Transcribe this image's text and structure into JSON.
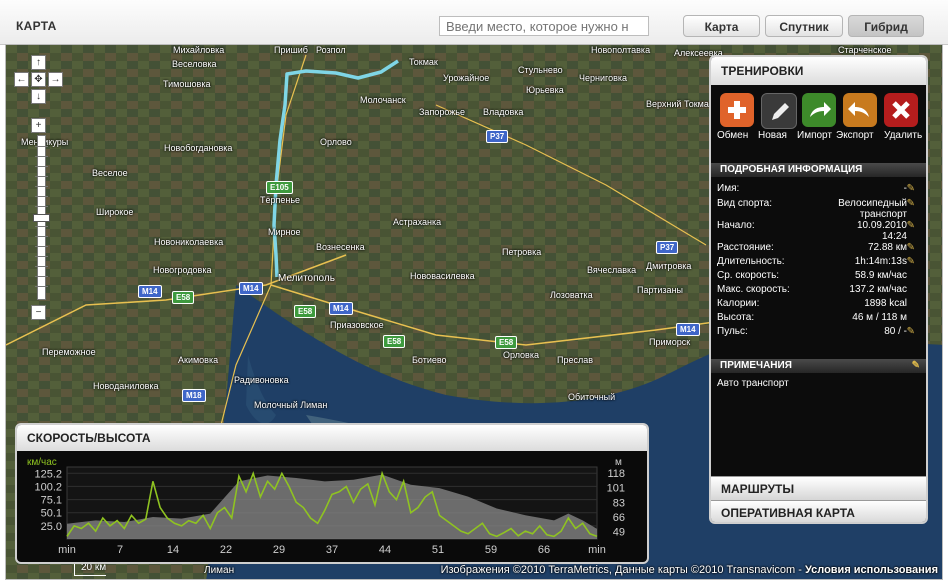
{
  "header": {
    "title": "КАРТА",
    "search_placeholder": "Введи место, которое нужно н",
    "map_types": [
      {
        "label": "Карта",
        "active": false
      },
      {
        "label": "Спутник",
        "active": false
      },
      {
        "label": "Гибрид",
        "active": true
      }
    ]
  },
  "map": {
    "places": [
      "Михайловка",
      "Пришиб",
      "Розпол",
      "Новополтавка",
      "Алексеевка",
      "Старченское",
      "Токмак",
      "Веселовка",
      "Тимошовка",
      "Урожайное",
      "Стульнево",
      "Юрьевка",
      "Молочанск",
      "Запорожье",
      "Черниговка",
      "Владовка",
      "Верхний Токмак",
      "Менчикуры",
      "Новобогдановка",
      "Орлово",
      "Тёрпенье",
      "Веселое",
      "Широкое",
      "Астраханка",
      "Новониколаевка",
      "Мирное",
      "Вознесенка",
      "Петровка",
      "Новогродовка",
      "Мелитополь",
      "Нововасилевка",
      "Вячеславка",
      "Дмитровка",
      "Партизаны",
      "Приазовское",
      "Лозоватка",
      "Переможное",
      "Акимовка",
      "Ботиево",
      "Приморск",
      "Орловка",
      "Преслав",
      "Радивоновка",
      "Новоданиловка",
      "Обиточный",
      "Молочный Лиман",
      "Лиман"
    ],
    "roads": [
      "M14",
      "E58",
      "P37",
      "M18",
      "E105"
    ],
    "scale_label": "20 км",
    "copyright_text": "Изображения ©2010 TerraMetrics, Данные карты ©2010 Transnavicom - ",
    "terms_link": "Условия использования"
  },
  "workouts_panel": {
    "title": "ТРЕНИРОВКИ",
    "toolbar": [
      {
        "label": "Обмен",
        "icon": "plus-icon",
        "color": "#e0632a"
      },
      {
        "label": "Новая",
        "icon": "pencil-icon",
        "color": "#3a3a3a"
      },
      {
        "label": "Импорт",
        "icon": "import-arrow-icon",
        "color": "#3d8a2a"
      },
      {
        "label": "Экспорт",
        "icon": "export-arrow-icon",
        "color": "#c87a1e"
      },
      {
        "label": "Удалить",
        "icon": "delete-x-icon",
        "color": "#b51d1d"
      }
    ],
    "details_title": "ПОДРОБНАЯ ИНФОРМАЦИЯ",
    "details": [
      {
        "key": "Имя:",
        "value": "-"
      },
      {
        "key": "Вид спорта:",
        "value": "Велосипедный транспорт"
      },
      {
        "key": "Начало:",
        "value": "10.09.2010 14:24"
      },
      {
        "key": "Расстояние:",
        "value": "72.88 км"
      },
      {
        "key": "Длительность:",
        "value": "1h:14m:13s"
      },
      {
        "key": "Ср. скорость:",
        "value": "58.9 км/час"
      },
      {
        "key": "Макс. скорость:",
        "value": "137.2 км/час"
      },
      {
        "key": "Калории:",
        "value": "1898 kcal"
      },
      {
        "key": "Высота:",
        "value": "46 м / 118 м"
      },
      {
        "key": "Пульс:",
        "value": "80 / -"
      }
    ],
    "notes_title": "ПРИМЕЧАНИЯ",
    "notes_text": "Авто транспорт",
    "routes_label": "МАРШРУТЫ",
    "live_map_label": "ОПЕРАТИВНАЯ КАРТА"
  },
  "chart_data": {
    "type": "line",
    "title": "СКОРОСТЬ/ВЫСОТА",
    "ylabel": "км/час",
    "y2label": "м",
    "x_tick_labels": [
      "min",
      "7",
      "14",
      "22",
      "29",
      "37",
      "44",
      "51",
      "59",
      "66",
      "min"
    ],
    "y_ticks": [
      "125.2",
      "100.2",
      "75.1",
      "50.1",
      "25.0"
    ],
    "y2_ticks": [
      "118",
      "101",
      "83",
      "66",
      "49"
    ],
    "ylim": [
      0,
      137.2
    ],
    "y2lim": [
      40,
      125
    ],
    "xlim": [
      0,
      74
    ],
    "series": [
      {
        "name": "speed",
        "color": "#8fc321",
        "x": [
          0,
          1,
          2,
          3,
          4,
          5,
          6,
          7,
          8,
          9,
          10,
          11,
          12,
          13,
          14,
          15,
          16,
          17,
          18,
          19,
          20,
          21,
          22,
          23,
          24,
          25,
          26,
          27,
          28,
          29,
          30,
          31,
          32,
          33,
          34,
          35,
          36,
          37,
          38,
          39,
          40,
          41,
          42,
          43,
          44,
          45,
          46,
          47,
          48,
          49,
          50,
          51,
          52,
          53,
          54,
          55,
          56,
          57,
          58,
          59,
          60,
          61,
          62,
          63,
          64,
          65,
          66,
          67,
          68,
          69,
          70,
          71,
          72,
          73,
          74
        ],
        "values": [
          5,
          25,
          20,
          30,
          15,
          40,
          25,
          35,
          20,
          45,
          30,
          38,
          110,
          60,
          40,
          30,
          25,
          35,
          30,
          45,
          20,
          50,
          60,
          40,
          120,
          90,
          125,
          80,
          110,
          95,
          125,
          100,
          70,
          60,
          40,
          30,
          55,
          85,
          90,
          100,
          70,
          95,
          105,
          65,
          125,
          90,
          75,
          110,
          50,
          60,
          80,
          90,
          45,
          35,
          25,
          15,
          10,
          20,
          30,
          10,
          5,
          12,
          20,
          6,
          15,
          10,
          25,
          8,
          5,
          15,
          40,
          20,
          30,
          10,
          5
        ]
      },
      {
        "name": "elevation",
        "color": "#8a8a8a",
        "x": [
          0,
          4,
          8,
          12,
          16,
          20,
          24,
          28,
          32,
          36,
          40,
          44,
          48,
          52,
          56,
          60,
          64,
          68,
          70,
          72,
          74
        ],
        "values": [
          58,
          62,
          60,
          66,
          64,
          70,
          108,
          115,
          112,
          108,
          110,
          116,
          104,
          100,
          90,
          76,
          68,
          62,
          70,
          62,
          52
        ]
      }
    ]
  }
}
